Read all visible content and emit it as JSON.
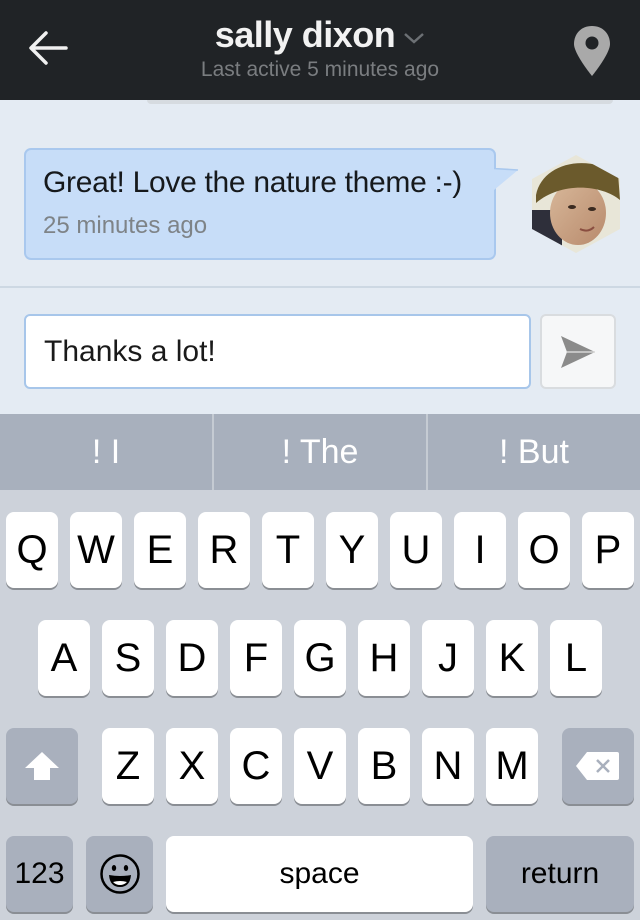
{
  "header": {
    "title": "sally dixon",
    "subtitle": "Last active 5 minutes ago",
    "icons": {
      "back": "arrow-left-icon",
      "dropdown": "chevron-down-icon",
      "location": "map-pin-icon"
    }
  },
  "messages": [
    {
      "text": "Great! Love the nature theme :-)",
      "time": "25 minutes ago",
      "sender_avatar": "avatar-photo"
    }
  ],
  "compose": {
    "value": "Thanks a lot!",
    "send_icon": "paper-plane-icon"
  },
  "suggestions": [
    "! I",
    "! The",
    "! But"
  ],
  "keyboard": {
    "row1": [
      "Q",
      "W",
      "E",
      "R",
      "T",
      "Y",
      "U",
      "I",
      "O",
      "P"
    ],
    "row2": [
      "A",
      "S",
      "D",
      "F",
      "G",
      "H",
      "J",
      "K",
      "L"
    ],
    "row3": [
      "Z",
      "X",
      "C",
      "V",
      "B",
      "N",
      "M"
    ],
    "shift_icon": "shift-arrow-icon",
    "delete_icon": "backspace-icon",
    "numbers_label": "123",
    "emoji_icon": "emoji-smiley-icon",
    "space_label": "space",
    "return_label": "return"
  },
  "colors": {
    "header_bg": "#202326",
    "bubble_bg": "#c7ddf8",
    "bubble_border": "#a9c8ee",
    "page_bg": "#e4ebf3",
    "keyboard_bg": "#cdd2da",
    "suggest_bg": "#a8b0bd"
  }
}
